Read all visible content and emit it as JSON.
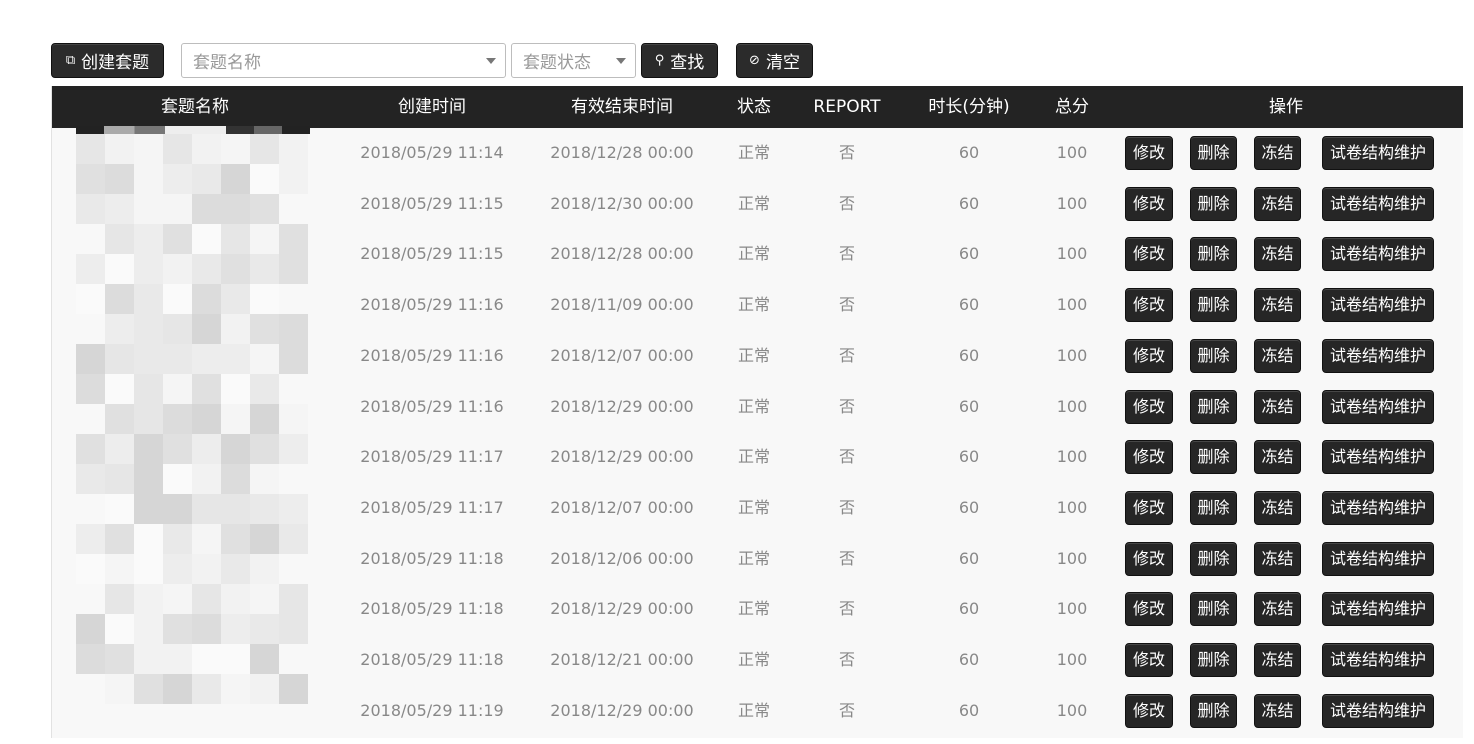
{
  "toolbar": {
    "create_label": "创建套题",
    "name_select_placeholder": "套题名称",
    "status_select_placeholder": "套题状态",
    "search_label": "查找",
    "clear_label": "清空"
  },
  "table": {
    "headers": [
      "套题名称",
      "创建时间",
      "有效结束时间",
      "状态",
      "REPORT",
      "时长(分钟)",
      "总分",
      "操作"
    ],
    "action_labels": {
      "edit": "修改",
      "delete": "删除",
      "freeze": "冻结",
      "maintain": "试卷结构维护"
    },
    "rows": [
      {
        "created": "2018/05/29 11:14",
        "end": "2018/12/28 00:00",
        "status": "正常",
        "report": "否",
        "duration": "60",
        "total": "100"
      },
      {
        "created": "2018/05/29 11:15",
        "end": "2018/12/30 00:00",
        "status": "正常",
        "report": "否",
        "duration": "60",
        "total": "100"
      },
      {
        "created": "2018/05/29 11:15",
        "end": "2018/12/28 00:00",
        "status": "正常",
        "report": "否",
        "duration": "60",
        "total": "100"
      },
      {
        "created": "2018/05/29 11:16",
        "end": "2018/11/09 00:00",
        "status": "正常",
        "report": "否",
        "duration": "60",
        "total": "100"
      },
      {
        "created": "2018/05/29 11:16",
        "end": "2018/12/07 00:00",
        "status": "正常",
        "report": "否",
        "duration": "60",
        "total": "100"
      },
      {
        "created": "2018/05/29 11:16",
        "end": "2018/12/29 00:00",
        "status": "正常",
        "report": "否",
        "duration": "60",
        "total": "100"
      },
      {
        "created": "2018/05/29 11:17",
        "end": "2018/12/29 00:00",
        "status": "正常",
        "report": "否",
        "duration": "60",
        "total": "100"
      },
      {
        "created": "2018/05/29 11:17",
        "end": "2018/12/07 00:00",
        "status": "正常",
        "report": "否",
        "duration": "60",
        "total": "100"
      },
      {
        "created": "2018/05/29 11:18",
        "end": "2018/12/06 00:00",
        "status": "正常",
        "report": "否",
        "duration": "60",
        "total": "100"
      },
      {
        "created": "2018/05/29 11:18",
        "end": "2018/12/29 00:00",
        "status": "正常",
        "report": "否",
        "duration": "60",
        "total": "100"
      },
      {
        "created": "2018/05/29 11:18",
        "end": "2018/12/21 00:00",
        "status": "正常",
        "report": "否",
        "duration": "60",
        "total": "100"
      },
      {
        "created": "2018/05/29 11:19",
        "end": "2018/12/29 00:00",
        "status": "正常",
        "report": "否",
        "duration": "60",
        "total": "100"
      }
    ]
  },
  "icons": {
    "create": "new-window-icon",
    "search": "magnifier-icon",
    "clear": "ban-icon"
  }
}
